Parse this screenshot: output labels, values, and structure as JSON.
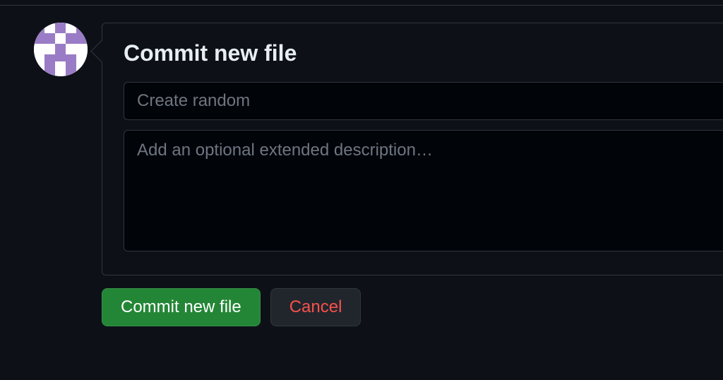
{
  "panel": {
    "title": "Commit new file"
  },
  "form": {
    "message_placeholder": "Create random",
    "message_value": "",
    "description_placeholder": "Add an optional extended description…",
    "description_value": ""
  },
  "buttons": {
    "commit_label": "Commit new file",
    "cancel_label": "Cancel"
  },
  "colors": {
    "primary_green": "#238636",
    "danger_red": "#f85149",
    "bg": "#0d1117"
  }
}
